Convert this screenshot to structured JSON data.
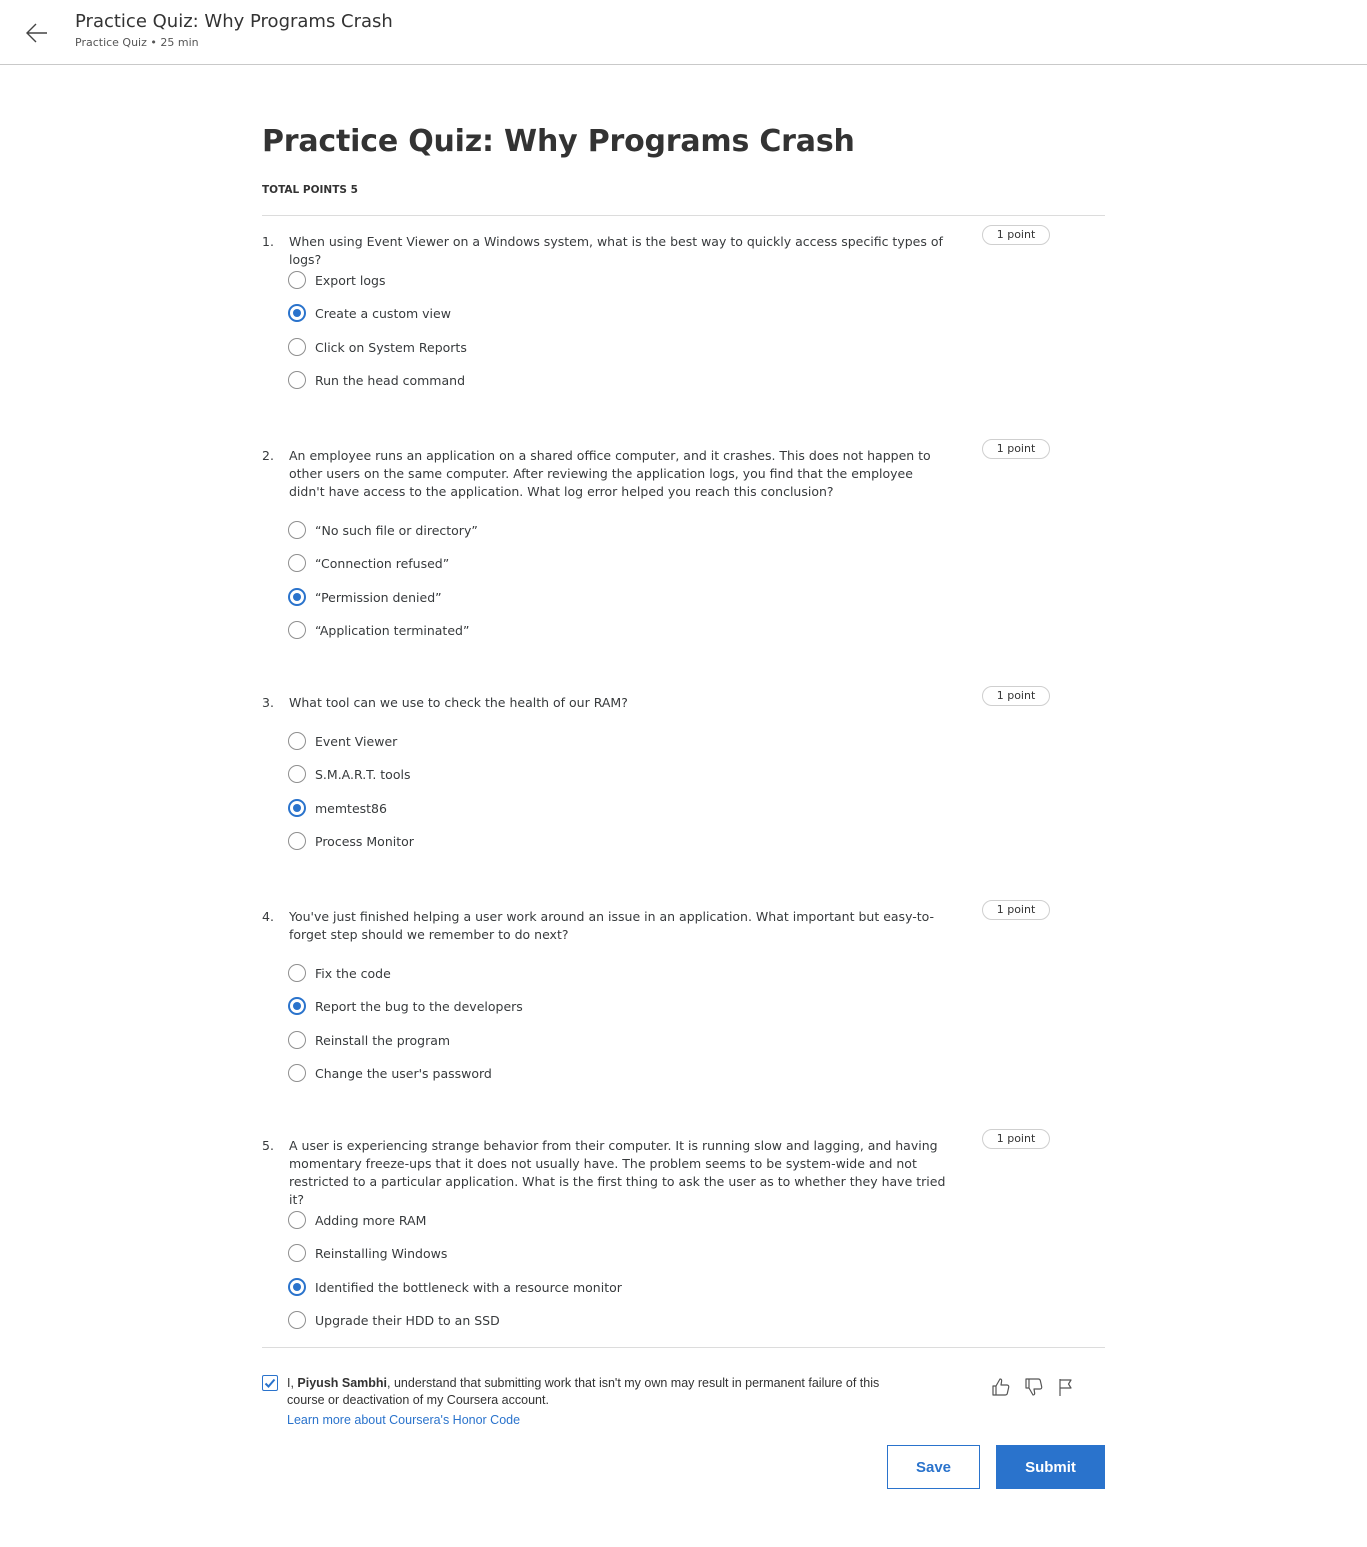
{
  "header": {
    "title": "Practice Quiz: Why Programs Crash",
    "subtitle": "Practice Quiz • 25 min"
  },
  "quiz": {
    "title": "Practice Quiz: Why Programs Crash",
    "total_points_label": "TOTAL POINTS 5"
  },
  "questions": [
    {
      "number": "1.",
      "text": "When using Event Viewer on a Windows system, what is the best way to quickly access specific types of logs?",
      "points": "1 point",
      "options": [
        "Export logs",
        "Create a custom view",
        "Click on System Reports",
        "Run the head command"
      ],
      "selected": 1
    },
    {
      "number": "2.",
      "text": "An employee runs an application on a shared office computer, and it crashes. This does not happen to other users on the same computer. After reviewing the application logs, you find that the employee didn't have access to the application. What log error helped you reach this conclusion?",
      "points": "1 point",
      "options": [
        "“No such file or directory”",
        "“Connection refused”",
        "“Permission denied”",
        "“Application terminated”"
      ],
      "selected": 2
    },
    {
      "number": "3.",
      "text": "What tool can we use to check the health of our RAM?",
      "points": "1 point",
      "options": [
        "Event Viewer",
        "S.M.A.R.T. tools",
        "memtest86",
        "Process Monitor"
      ],
      "selected": 2
    },
    {
      "number": "4.",
      "text": "You've just finished helping a user work around an issue in an application. What important but easy-to-forget step should we remember to do next?",
      "points": "1 point",
      "options": [
        "Fix the code",
        "Report the bug to the developers",
        "Reinstall the program",
        "Change the user's password"
      ],
      "selected": 1
    },
    {
      "number": "5.",
      "text": "A user is experiencing strange behavior from their computer. It is running slow and lagging, and having momentary freeze-ups that it does not usually have. The problem seems to be system-wide and not restricted to a particular application. What is the first thing to ask the user as to whether they have tried it?",
      "points": "1 point",
      "options": [
        "Adding more RAM",
        "Reinstalling Windows",
        "Identified the bottleneck with a resource monitor",
        "Upgrade their HDD to an SSD"
      ],
      "selected": 2
    }
  ],
  "honor_code": {
    "checked": true,
    "prefix": "I, ",
    "name": "Piyush Sambhi",
    "suffix": ", understand that submitting work that isn't my own may result in permanent failure of this course or deactivation of my Coursera account.",
    "link_text": "Learn more about Coursera's Honor Code"
  },
  "feedback": {
    "icons": [
      "thumbs-up-icon",
      "thumbs-down-icon",
      "flag-icon"
    ]
  },
  "actions": {
    "save_label": "Save",
    "submit_label": "Submit"
  },
  "colors": {
    "accent": "#2a73cc",
    "text": "#373a3c",
    "divider": "#dcdcdc"
  }
}
